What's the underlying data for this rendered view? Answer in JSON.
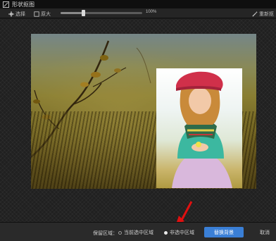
{
  "window": {
    "title": "形状抠图"
  },
  "toolbar": {
    "select_label": "选择",
    "zoom_label": "原大",
    "zoom_value": "100%",
    "zoom_fraction": 0.28,
    "reset_label": "重新抠"
  },
  "bottom": {
    "keep_area_label": "保留区域：",
    "option_current": "当前选中区域",
    "option_unselected": "非选中区域",
    "selected_option": "option_unselected",
    "replace_button": "替换背景",
    "cancel_button": "取消"
  },
  "colors": {
    "accent": "#3a7fd6",
    "annotation_arrow": "#e01010"
  },
  "icons": {
    "app": "scissors-icon",
    "select": "move-icon",
    "zoom": "zoom-icon",
    "reset": "magic-wand-icon"
  }
}
